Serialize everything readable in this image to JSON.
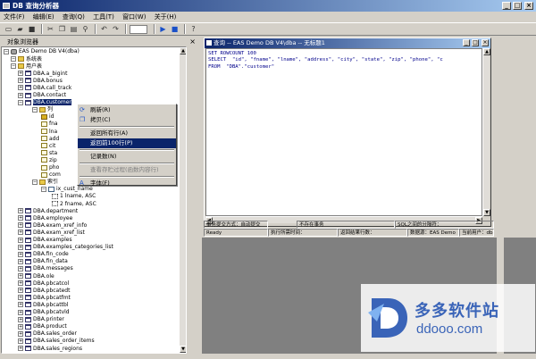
{
  "app": {
    "title": "DB 查询分析器"
  },
  "menu": [
    "文件(F)",
    "编辑(E)",
    "查询(Q)",
    "工具(T)",
    "窗口(W)",
    "关于(H)"
  ],
  "object_browser": {
    "title": "对象浏览器",
    "root": "EAS Demo DB V4(dba)",
    "nodes": [
      {
        "label": "系统表",
        "icon": "folder",
        "level": 1
      },
      {
        "label": "用户表",
        "icon": "folder",
        "level": 1
      },
      {
        "label": "DBA.a_bigint",
        "icon": "table",
        "level": 2
      },
      {
        "label": "DBA.bonus",
        "icon": "table",
        "level": 2
      },
      {
        "label": "DBA.call_track",
        "icon": "table",
        "level": 2
      },
      {
        "label": "DBA.contact",
        "icon": "table",
        "level": 2
      },
      {
        "label": "DBA.customer",
        "icon": "table",
        "level": 2,
        "selected": true
      },
      {
        "label": "列",
        "icon": "folder",
        "level": 3
      },
      {
        "label": "id",
        "icon": "key",
        "level": 4
      },
      {
        "label": "fna",
        "icon": "column",
        "level": 4
      },
      {
        "label": "lna",
        "icon": "column",
        "level": 4
      },
      {
        "label": "add",
        "icon": "column",
        "level": 4
      },
      {
        "label": "cit",
        "icon": "column",
        "level": 4
      },
      {
        "label": "sta",
        "icon": "column",
        "level": 4
      },
      {
        "label": "zip",
        "icon": "column",
        "level": 4
      },
      {
        "label": "pho",
        "icon": "column",
        "level": 4
      },
      {
        "label": "com",
        "icon": "column",
        "level": 4
      },
      {
        "label": "索引",
        "icon": "folder",
        "level": 3
      },
      {
        "label": "ix_cust_name",
        "icon": "index",
        "level": 4
      },
      {
        "label": "1  lname, ASC",
        "icon": "dot",
        "level": 5
      },
      {
        "label": "2  fname, ASC",
        "icon": "dot",
        "level": 5
      },
      {
        "label": "DBA.department",
        "icon": "table",
        "level": 2
      },
      {
        "label": "DBA.employee",
        "icon": "table",
        "level": 2
      },
      {
        "label": "DBA.exam_xref_info",
        "icon": "table",
        "level": 2
      },
      {
        "label": "DBA.exam_xref_list",
        "icon": "table",
        "level": 2
      },
      {
        "label": "DBA.examples",
        "icon": "table",
        "level": 2
      },
      {
        "label": "DBA.examples_categories_list",
        "icon": "table",
        "level": 2
      },
      {
        "label": "DBA.fin_code",
        "icon": "table",
        "level": 2
      },
      {
        "label": "DBA.fin_data",
        "icon": "table",
        "level": 2
      },
      {
        "label": "DBA.messages",
        "icon": "table",
        "level": 2
      },
      {
        "label": "DBA.ole",
        "icon": "table",
        "level": 2
      },
      {
        "label": "DBA.pbcatcol",
        "icon": "table",
        "level": 2
      },
      {
        "label": "DBA.pbcatedt",
        "icon": "table",
        "level": 2
      },
      {
        "label": "DBA.pbcatfmt",
        "icon": "table",
        "level": 2
      },
      {
        "label": "DBA.pbcattbl",
        "icon": "table",
        "level": 2
      },
      {
        "label": "DBA.pbcatvld",
        "icon": "table",
        "level": 2
      },
      {
        "label": "DBA.printer",
        "icon": "table",
        "level": 2
      },
      {
        "label": "DBA.product",
        "icon": "table",
        "level": 2
      },
      {
        "label": "DBA.sales_order",
        "icon": "table",
        "level": 2
      },
      {
        "label": "DBA.sales_order_items",
        "icon": "table",
        "level": 2
      },
      {
        "label": "DBA.sales_regions",
        "icon": "table",
        "level": 2
      }
    ]
  },
  "context_menu": {
    "items": [
      {
        "label": "刷新(R)",
        "icon": "refresh"
      },
      {
        "label": "拷贝(C)",
        "icon": "copy"
      },
      {
        "sep": true
      },
      {
        "label": "返回所有行(A)"
      },
      {
        "label": "返回前100行(P)",
        "highlighted": true
      },
      {
        "sep": true
      },
      {
        "label": "记录数(N)"
      },
      {
        "sep": true
      },
      {
        "label": "查看存贮过程(函数内容行)",
        "disabled": true
      },
      {
        "sep": true
      },
      {
        "label": "字体(F)",
        "icon": "font"
      }
    ]
  },
  "query_window": {
    "title": "查询 -- EAS Demo DB V4\\dba -- 无标题1",
    "sql_lines": [
      "SET ROWCOUNT 100",
      "SELECT  \"id\", \"fname\", \"lname\", \"address\", \"city\", \"state\", \"zip\", \"phone\", \"c",
      "FROM  \"DBA\".\"customer\""
    ]
  },
  "status": {
    "row1": [
      "事务提交方式：自动提交",
      "不存在事务",
      "SQL之间的分隔符："
    ],
    "row2": [
      "Ready",
      "执行所需时间：",
      "返回结果行数：",
      "数据源：EAS Demo",
      "当前用户：dba"
    ]
  },
  "watermark": {
    "cn": "多多软件站",
    "url": "ddooo.com"
  }
}
